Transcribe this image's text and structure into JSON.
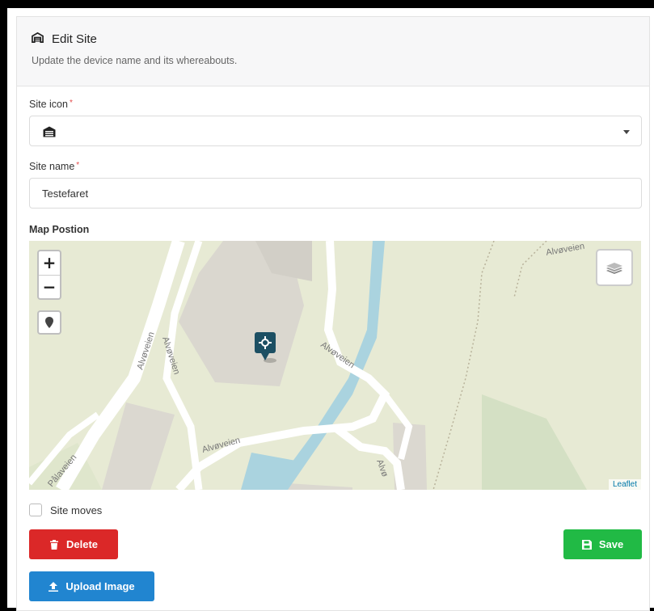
{
  "header": {
    "title": "Edit Site",
    "subtitle": "Update the device name and its whereabouts."
  },
  "site_icon": {
    "label": "Site icon",
    "required_mark": "*",
    "selected_icon": "garage-icon"
  },
  "site_name": {
    "label": "Site name",
    "required_mark": "*",
    "value": "Testefaret"
  },
  "map": {
    "label": "Map Postion",
    "zoom_in": "+",
    "zoom_out": "−",
    "attribution": "Leaflet",
    "street_labels": [
      "Alvøveien",
      "Alvøveien",
      "Alvøveien",
      "Alvøveien",
      "Alvøveien",
      "Alvø",
      "Pålaveien"
    ]
  },
  "site_moves": {
    "label": "Site moves",
    "checked": false
  },
  "buttons": {
    "delete": "Delete",
    "save": "Save",
    "upload": "Upload Image"
  },
  "colors": {
    "delete": "#db2828",
    "save": "#21ba45",
    "upload": "#2185d0",
    "required": "#e34b4b",
    "marker": "#1c4f63"
  }
}
